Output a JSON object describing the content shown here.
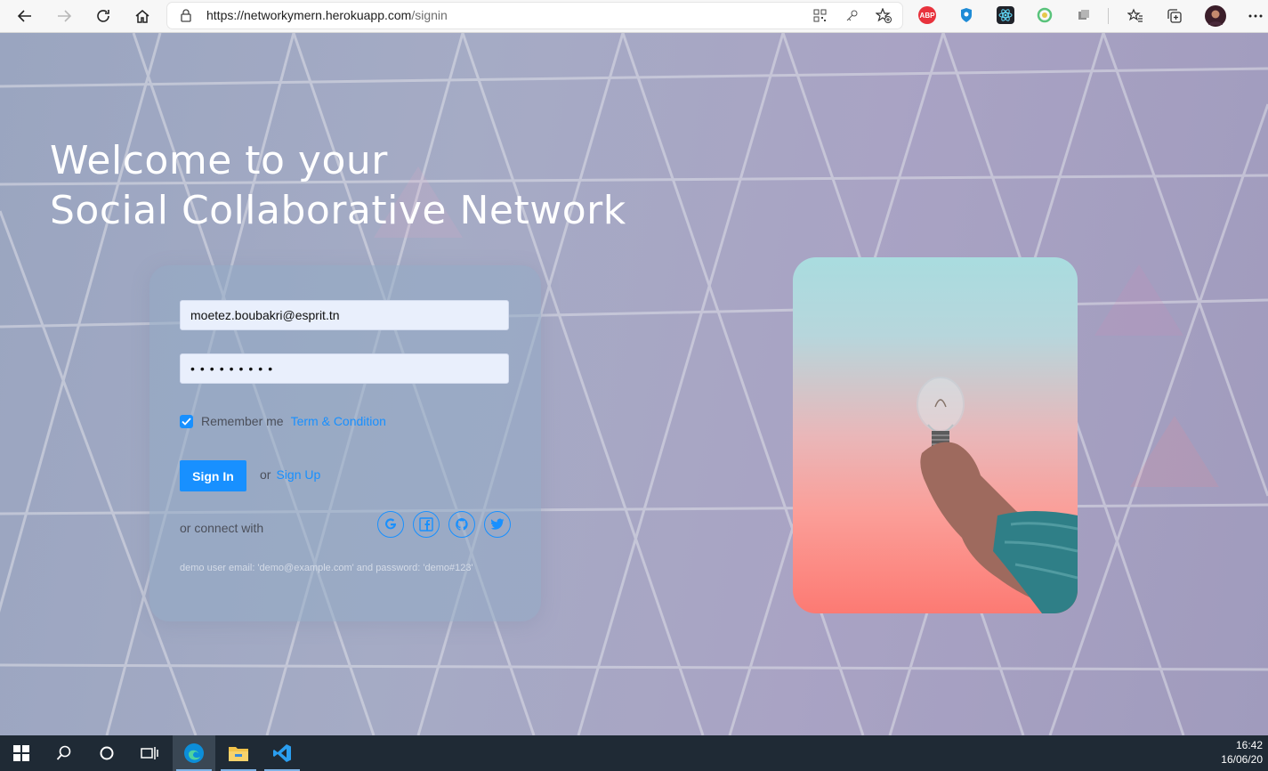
{
  "browser": {
    "url_host": "https://networkymern.herokuapp.com",
    "url_path": "/signin",
    "extensions": [
      "ABP",
      "shield",
      "react-devtools",
      "circle-ext",
      "cube-ext"
    ]
  },
  "hero": {
    "line1": "Welcome to your",
    "line2": "Social Collaborative Network"
  },
  "form": {
    "email_value": "moetez.boubakri@esprit.tn",
    "password_mask": "•••••••••",
    "remember_label": "Remember me",
    "remember_checked": true,
    "terms_label": "Term & Condition",
    "signin_label": "Sign In",
    "or_text": "or",
    "signup_label": "Sign Up",
    "connect_label": "or connect with",
    "social": [
      "google",
      "facebook",
      "github",
      "twitter"
    ],
    "demo_note": "demo user email: 'demo@example.com' and password: 'demo#123'"
  },
  "taskbar": {
    "time": "16:42",
    "date": "16/06/20"
  },
  "colors": {
    "accent": "#1890ff",
    "taskbar": "#1f2a35"
  }
}
